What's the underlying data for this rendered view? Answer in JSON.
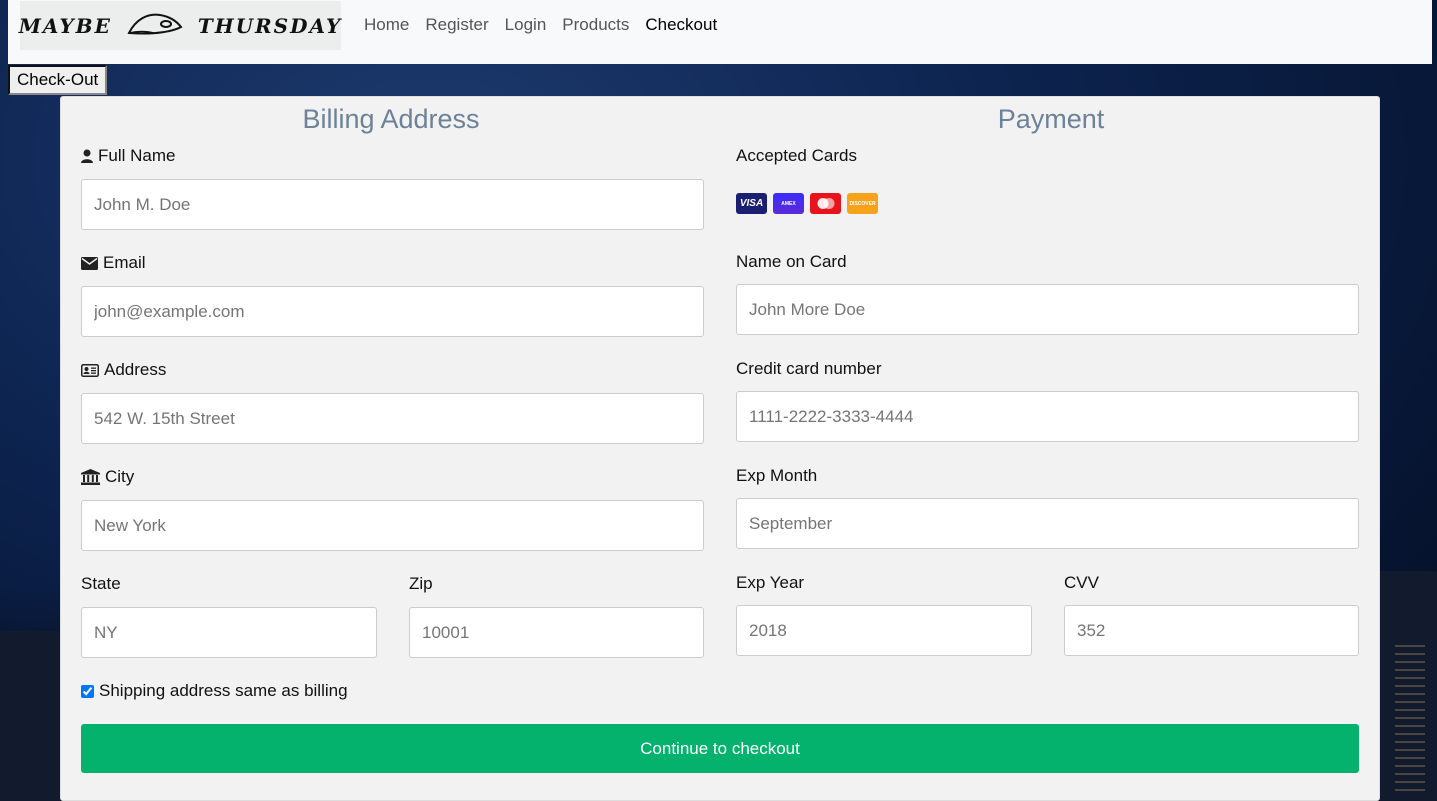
{
  "brand": {
    "left": "MAYBE",
    "right": "THURSDAY"
  },
  "nav": {
    "items": [
      "Home",
      "Register",
      "Login",
      "Products",
      "Checkout"
    ],
    "active": "Checkout"
  },
  "checkout_button": "Check-Out",
  "billing": {
    "title": "Billing Address",
    "full_name": {
      "label": "Full Name",
      "placeholder": "John M. Doe"
    },
    "email": {
      "label": "Email",
      "placeholder": "john@example.com"
    },
    "address": {
      "label": "Address",
      "placeholder": "542 W. 15th Street"
    },
    "city": {
      "label": "City",
      "placeholder": "New York"
    },
    "state": {
      "label": "State",
      "placeholder": "NY"
    },
    "zip": {
      "label": "Zip",
      "placeholder": "10001"
    }
  },
  "payment": {
    "title": "Payment",
    "accepted_cards_label": "Accepted Cards",
    "cards": [
      "visa-icon",
      "amex-icon",
      "mastercard-icon",
      "discover-icon"
    ],
    "name_on_card": {
      "label": "Name on Card",
      "placeholder": "John More Doe"
    },
    "card_number": {
      "label": "Credit card number",
      "placeholder": "1111-2222-3333-4444"
    },
    "exp_month": {
      "label": "Exp Month",
      "placeholder": "September"
    },
    "exp_year": {
      "label": "Exp Year",
      "placeholder": "2018"
    },
    "cvv": {
      "label": "CVV",
      "placeholder": "352"
    }
  },
  "shipping_same": {
    "label": "Shipping address same as billing",
    "checked": true
  },
  "submit_label": "Continue to checkout",
  "colors": {
    "accent": "#04b26e",
    "title": "#6d8198"
  }
}
